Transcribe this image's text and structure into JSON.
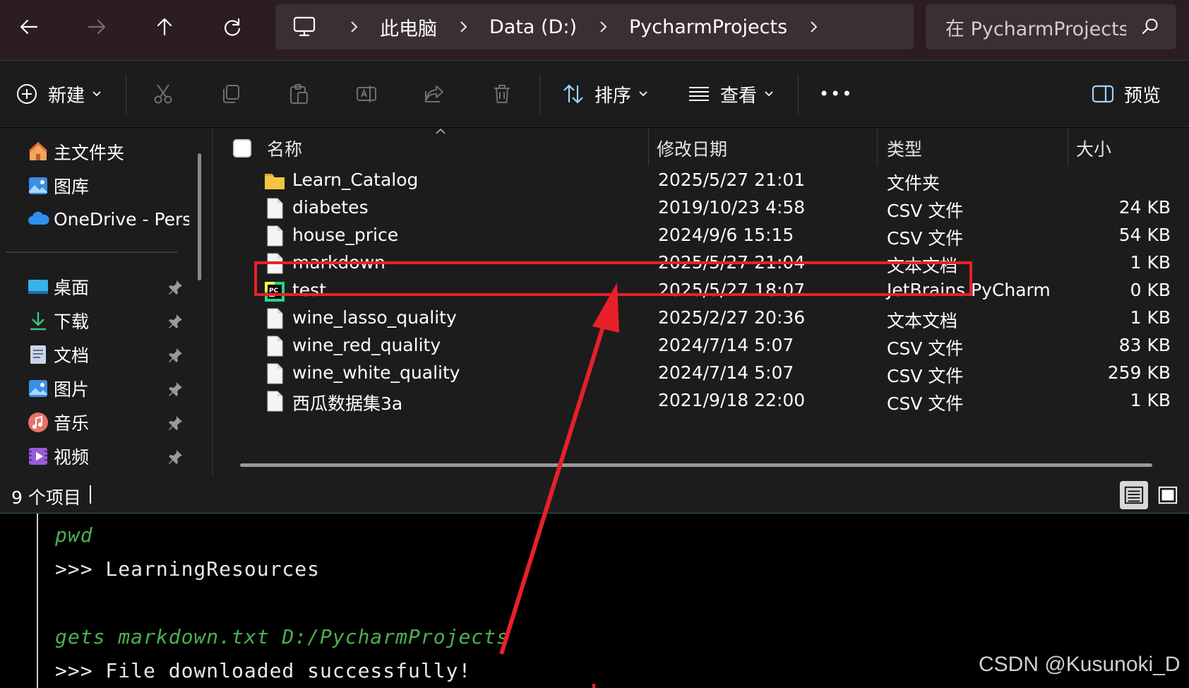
{
  "address": {
    "breadcrumbs": [
      "此电脑",
      "Data (D:)",
      "PycharmProjects"
    ],
    "search_placeholder": "在 PycharmProjects 中搜索"
  },
  "toolbar": {
    "new_label": "新建",
    "sort_label": "排序",
    "view_label": "查看",
    "more_label": "•••",
    "preview_label": "预览"
  },
  "sidebar": {
    "top_items": [
      {
        "label": "主文件夹",
        "icon": "home-icon"
      },
      {
        "label": "图库",
        "icon": "gallery-icon"
      },
      {
        "label": "OneDrive - Personal",
        "icon": "onedrive-icon"
      }
    ],
    "pinned_items": [
      {
        "label": "桌面",
        "icon": "desktop-icon"
      },
      {
        "label": "下载",
        "icon": "download-icon"
      },
      {
        "label": "文档",
        "icon": "documents-icon"
      },
      {
        "label": "图片",
        "icon": "pictures-icon"
      },
      {
        "label": "音乐",
        "icon": "music-icon"
      },
      {
        "label": "视频",
        "icon": "videos-icon"
      }
    ]
  },
  "columns": {
    "name": "名称",
    "date": "修改日期",
    "type": "类型",
    "size": "大小"
  },
  "files": [
    {
      "name": "Learn_Catalog",
      "date": "2025/5/27 21:01",
      "type": "文件夹",
      "size": "",
      "icon": "folder-icon"
    },
    {
      "name": "diabetes",
      "date": "2019/10/23 4:58",
      "type": "CSV 文件",
      "size": "24 KB",
      "icon": "file-icon"
    },
    {
      "name": "house_price",
      "date": "2024/9/6 15:15",
      "type": "CSV 文件",
      "size": "54 KB",
      "icon": "file-icon"
    },
    {
      "name": "markdown",
      "date": "2025/5/27 21:04",
      "type": "文本文档",
      "size": "1 KB",
      "icon": "file-icon"
    },
    {
      "name": "test",
      "date": "2025/5/27 18:07",
      "type": "JetBrains PyCharm",
      "size": "0 KB",
      "icon": "pycharm-icon"
    },
    {
      "name": "wine_lasso_quality",
      "date": "2025/2/27 20:36",
      "type": "文本文档",
      "size": "1 KB",
      "icon": "file-icon"
    },
    {
      "name": "wine_red_quality",
      "date": "2024/7/14 5:07",
      "type": "CSV 文件",
      "size": "83 KB",
      "icon": "file-icon"
    },
    {
      "name": "wine_white_quality",
      "date": "2024/7/14 5:07",
      "type": "CSV 文件",
      "size": "259 KB",
      "icon": "file-icon"
    },
    {
      "name": "西瓜数据集3a",
      "date": "2021/9/18 22:00",
      "type": "CSV 文件",
      "size": "1 KB",
      "icon": "file-icon"
    }
  ],
  "status": {
    "item_count": "9 个项目"
  },
  "terminal": {
    "lines": [
      {
        "text": "pwd",
        "kind": "command"
      },
      {
        "text": ">>> LearningResources",
        "kind": "output"
      },
      {
        "text": "gets markdown.txt D:/PycharmProjects",
        "kind": "command"
      },
      {
        "text": ">>> File downloaded successfully!",
        "kind": "output"
      }
    ]
  },
  "watermark": "CSDN @Kusunoki_D",
  "colors": {
    "annotation": "#e8202a",
    "terminal_command": "#4caf50",
    "folder": "#f5c542"
  }
}
